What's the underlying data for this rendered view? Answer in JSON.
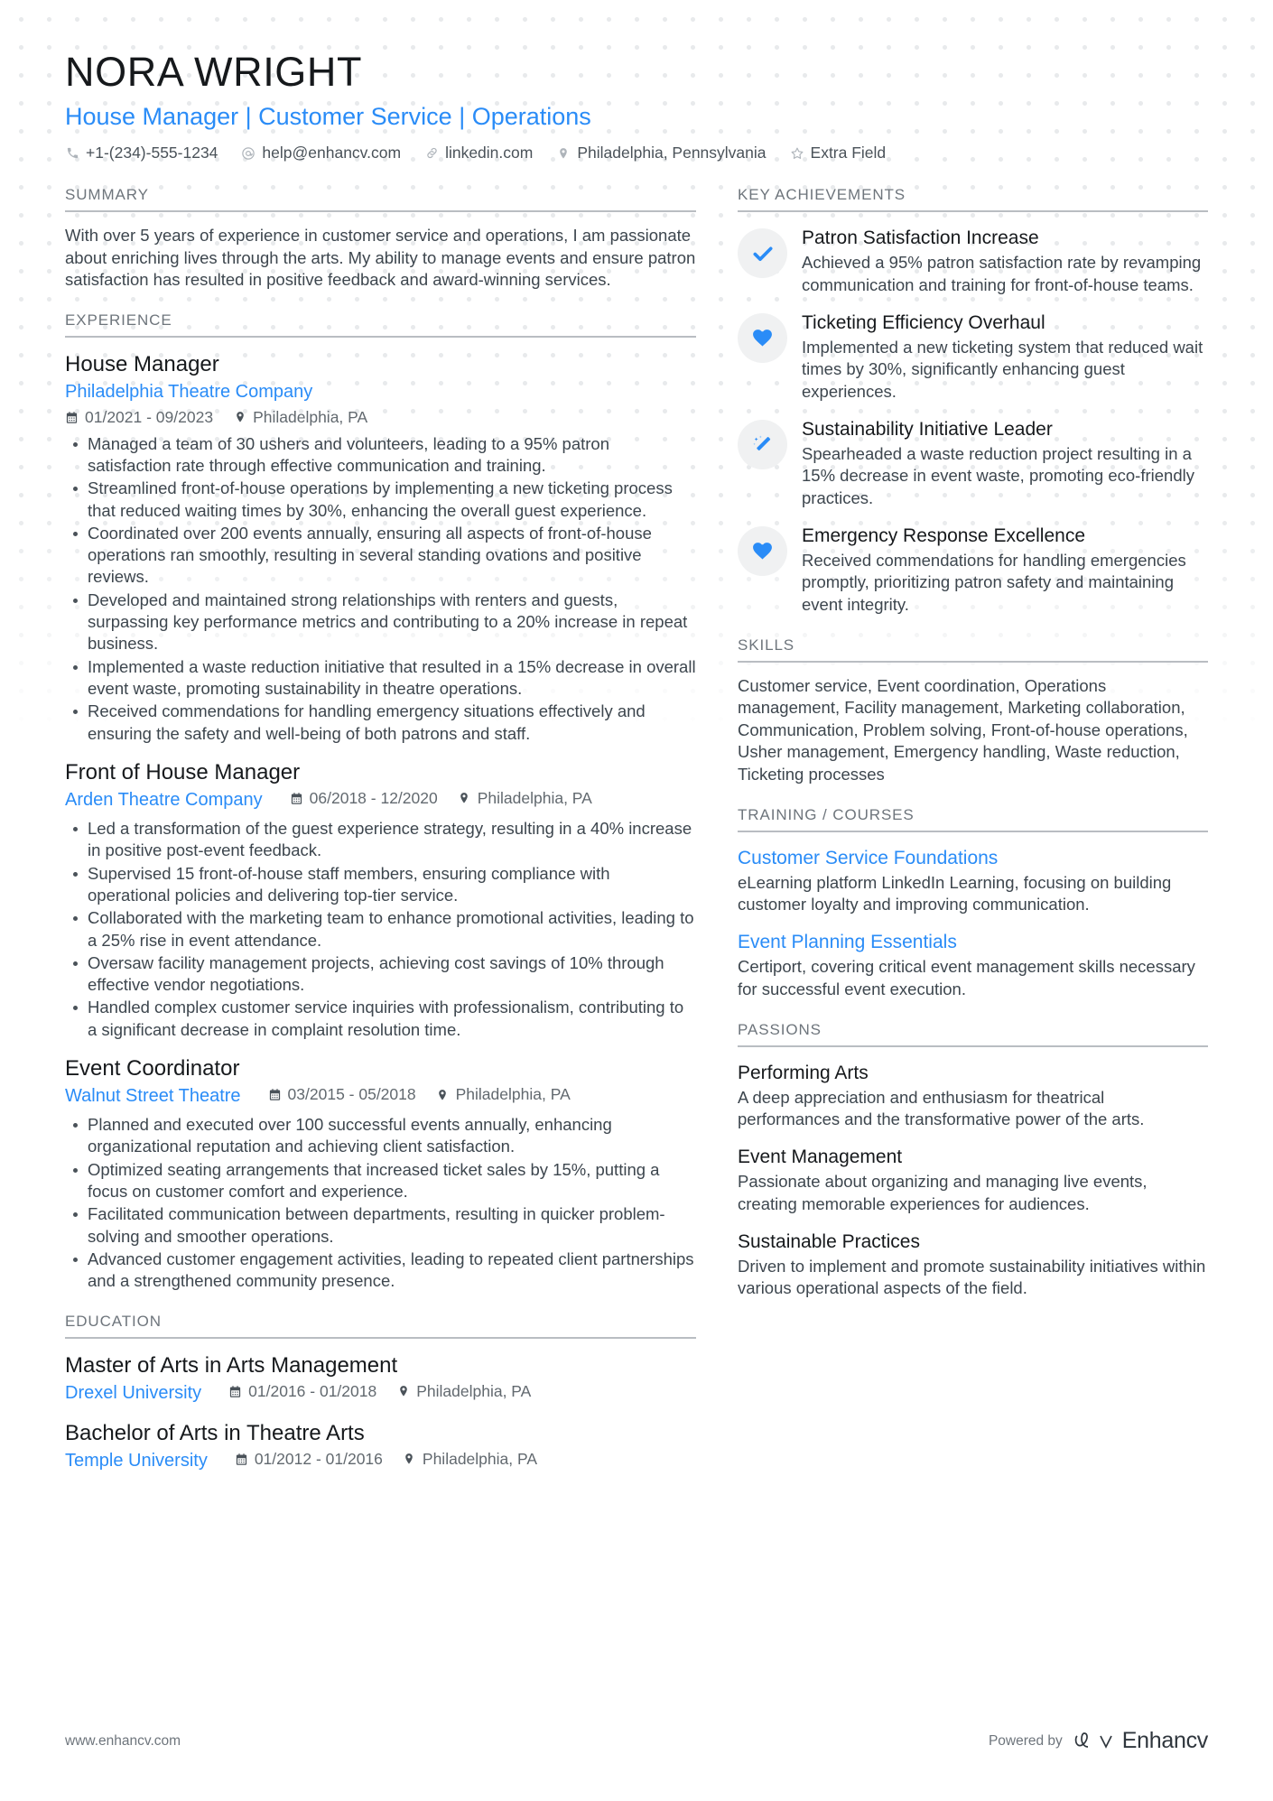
{
  "header": {
    "name": "NORA WRIGHT",
    "headline": "House Manager | Customer Service | Operations",
    "contacts": [
      {
        "icon": "phone-icon",
        "text": "+1-(234)-555-1234"
      },
      {
        "icon": "email-icon",
        "text": "help@enhancv.com"
      },
      {
        "icon": "link-icon",
        "text": "linkedin.com"
      },
      {
        "icon": "location-pin-icon",
        "text": "Philadelphia, Pennsylvania"
      },
      {
        "icon": "star-icon",
        "text": "Extra Field"
      }
    ]
  },
  "summary": {
    "title": "SUMMARY",
    "text": "With over 5 years of experience in customer service and operations, I am passionate about enriching lives through the arts. My ability to manage events and ensure patron satisfaction has resulted in positive feedback and award-winning services."
  },
  "experience": {
    "title": "EXPERIENCE",
    "entries": [
      {
        "role": "House Manager",
        "company": "Philadelphia Theatre Company",
        "dates": "01/2021 - 09/2023",
        "location": "Philadelphia, PA",
        "layout": "stacked",
        "bullets": [
          "Managed a team of 30 ushers and volunteers, leading to a 95% patron satisfaction rate through effective communication and training.",
          "Streamlined front-of-house operations by implementing a new ticketing process that reduced waiting times by 30%, enhancing the overall guest experience.",
          "Coordinated over 200 events annually, ensuring all aspects of front-of-house operations ran smoothly, resulting in several standing ovations and positive reviews.",
          "Developed and maintained strong relationships with renters and guests, surpassing key performance metrics and contributing to a 20% increase in repeat business.",
          "Implemented a waste reduction initiative that resulted in a 15% decrease in overall event waste, promoting sustainability in theatre operations.",
          "Received commendations for handling emergency situations effectively and ensuring the safety and well-being of both patrons and staff."
        ]
      },
      {
        "role": "Front of House Manager",
        "company": "Arden Theatre Company",
        "dates": "06/2018 - 12/2020",
        "location": "Philadelphia, PA",
        "layout": "inline",
        "bullets": [
          "Led a transformation of the guest experience strategy, resulting in a 40% increase in positive post-event feedback.",
          "Supervised 15 front-of-house staff members, ensuring compliance with operational policies and delivering top-tier service.",
          "Collaborated with the marketing team to enhance promotional activities, leading to a 25% rise in event attendance.",
          "Oversaw facility management projects, achieving cost savings of 10% through effective vendor negotiations.",
          "Handled complex customer service inquiries with professionalism, contributing to a significant decrease in complaint resolution time."
        ]
      },
      {
        "role": "Event Coordinator",
        "company": "Walnut Street Theatre",
        "dates": "03/2015 - 05/2018",
        "location": "Philadelphia, PA",
        "layout": "inline",
        "bullets": [
          "Planned and executed over 100 successful events annually, enhancing organizational reputation and achieving client satisfaction.",
          "Optimized seating arrangements that increased ticket sales by 15%, putting a focus on customer comfort and experience.",
          "Facilitated communication between departments, resulting in quicker problem-solving and smoother operations.",
          "Advanced customer engagement activities, leading to repeated client partnerships and a strengthened community presence."
        ]
      }
    ]
  },
  "education": {
    "title": "EDUCATION",
    "entries": [
      {
        "degree": "Master of Arts in Arts Management",
        "school": "Drexel University",
        "dates": "01/2016 - 01/2018",
        "location": "Philadelphia, PA"
      },
      {
        "degree": "Bachelor of Arts in Theatre Arts",
        "school": "Temple University",
        "dates": "01/2012 - 01/2016",
        "location": "Philadelphia, PA"
      }
    ]
  },
  "achievements": {
    "title": "KEY ACHIEVEMENTS",
    "items": [
      {
        "icon": "check-icon",
        "title": "Patron Satisfaction Increase",
        "desc": "Achieved a 95% patron satisfaction rate by revamping communication and training for front-of-house teams."
      },
      {
        "icon": "heart-icon",
        "title": "Ticketing Efficiency Overhaul",
        "desc": "Implemented a new ticketing system that reduced wait times by 30%, significantly enhancing guest experiences."
      },
      {
        "icon": "magic-wand-icon",
        "title": "Sustainability Initiative Leader",
        "desc": "Spearheaded a waste reduction project resulting in a 15% decrease in event waste, promoting eco-friendly practices."
      },
      {
        "icon": "heart-icon",
        "title": "Emergency Response Excellence",
        "desc": "Received commendations for handling emergencies promptly, prioritizing patron safety and maintaining event integrity."
      }
    ]
  },
  "skills": {
    "title": "SKILLS",
    "text": "Customer service, Event coordination, Operations management, Facility management, Marketing collaboration, Communication, Problem solving, Front-of-house operations, Usher management, Emergency handling, Waste reduction, Ticketing processes"
  },
  "training": {
    "title": "TRAINING / COURSES",
    "items": [
      {
        "name": "Customer Service Foundations",
        "desc": "eLearning platform LinkedIn Learning, focusing on building customer loyalty and improving communication."
      },
      {
        "name": "Event Planning Essentials",
        "desc": "Certiport, covering critical event management skills necessary for successful event execution."
      }
    ]
  },
  "passions": {
    "title": "PASSIONS",
    "items": [
      {
        "name": "Performing Arts",
        "desc": "A deep appreciation and enthusiasm for theatrical performances and the transformative power of the arts."
      },
      {
        "name": "Event Management",
        "desc": "Passionate about organizing and managing live events, creating memorable experiences for audiences."
      },
      {
        "name": "Sustainable Practices",
        "desc": "Driven to implement and promote sustainability initiatives within various operational aspects of the field."
      }
    ]
  },
  "footer": {
    "url": "www.enhancv.com",
    "powered_by": "Powered by",
    "brand": "Enhancv"
  },
  "colors": {
    "accent": "#2a8cf7",
    "heading": "#6e757c",
    "text": "#3d464e",
    "title": "#16191c"
  }
}
